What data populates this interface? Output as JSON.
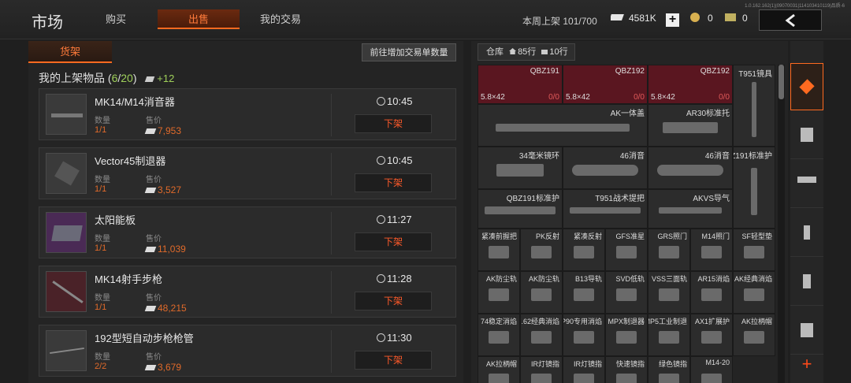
{
  "header": {
    "app_title": "市场",
    "tabs": [
      {
        "label": "购买"
      },
      {
        "label": "出售"
      },
      {
        "label": "我的交易"
      }
    ],
    "version": "1.0.162.162(1)|09070031|114103410119|品质-6",
    "weekly_label": "本周上架",
    "weekly_value": "101/700",
    "currency_bills": "4581K",
    "currency_coins": "0",
    "currency_tickets": "0"
  },
  "shelf": {
    "tab_label": "货架",
    "add_orders_label": "前往增加交易单数量",
    "summary_prefix": "我的上架物品 (",
    "summary_count": "6",
    "summary_slash": "/",
    "summary_total": "20",
    "summary_suffix": ")",
    "summary_bonus": "+12",
    "qty_label": "数量",
    "price_label": "售价",
    "delist_label": "下架",
    "listings": [
      {
        "name": "MK14/M14消音器",
        "qty": "1/1",
        "price": "7,953",
        "time": "10:45"
      },
      {
        "name": "Vector45制退器",
        "qty": "1/1",
        "price": "3,527",
        "time": "10:45"
      },
      {
        "name": "太阳能板",
        "qty": "1/1",
        "price": "11,039",
        "time": "11:27"
      },
      {
        "name": "MK14射手步枪",
        "qty": "1/1",
        "price": "48,215",
        "time": "11:28"
      },
      {
        "name": "192型短自动步枪枪管",
        "qty": "2/2",
        "price": "3,679",
        "time": "11:30"
      }
    ]
  },
  "warehouse": {
    "tab_label": "仓库",
    "rows": "85行",
    "cols": "10行",
    "cells": [
      {
        "name": "QBZ191",
        "cal": "5.8×42",
        "ammo": "0/0"
      },
      {
        "name": "QBZ192",
        "cal": "5.8×42",
        "ammo": "0/0"
      },
      {
        "name": "QBZ192",
        "cal": "5.8×42",
        "ammo": "0/0"
      },
      {
        "name": "T951镜具"
      },
      {
        "name": "AK一体盖"
      },
      {
        "name": "AR30标准托"
      },
      {
        "name": "34毫米镜环"
      },
      {
        "name": "46消音"
      },
      {
        "name": "46消音"
      },
      {
        "name": "QBZ191标准护"
      },
      {
        "name": "QBZ191标准护"
      },
      {
        "name": "T951战术提把"
      },
      {
        "name": "AKVS导气"
      },
      {
        "name": "紧凑前握把"
      },
      {
        "name": "PK反射"
      },
      {
        "name": "紧凑反射"
      },
      {
        "name": "GFS准星"
      },
      {
        "name": "GRS照门"
      },
      {
        "name": "M14照门"
      },
      {
        "name": "SF轻型垫"
      },
      {
        "name": "AK防尘轨"
      },
      {
        "name": "AK防尘轨"
      },
      {
        "name": "B13导轨"
      },
      {
        "name": "SVD低轨"
      },
      {
        "name": "VSS三面轨"
      },
      {
        "name": "AR15消焰"
      },
      {
        "name": "AK经典消焰"
      },
      {
        "name": "74稳定消焰"
      },
      {
        "name": "7.62经典消焰"
      },
      {
        "name": "P90专用消焰"
      },
      {
        "name": "MPX制退器"
      },
      {
        "name": "MP5工业制退"
      },
      {
        "name": "AX1扩展护"
      },
      {
        "name": "AK拉柄帽"
      },
      {
        "name": "AK拉柄帽"
      },
      {
        "name": "IR灯镜指"
      },
      {
        "name": "IR灯镜指"
      },
      {
        "name": "快速镜指"
      },
      {
        "name": "绿色镜指"
      },
      {
        "name": "M14-20"
      }
    ]
  },
  "side": {
    "plus": "+"
  }
}
